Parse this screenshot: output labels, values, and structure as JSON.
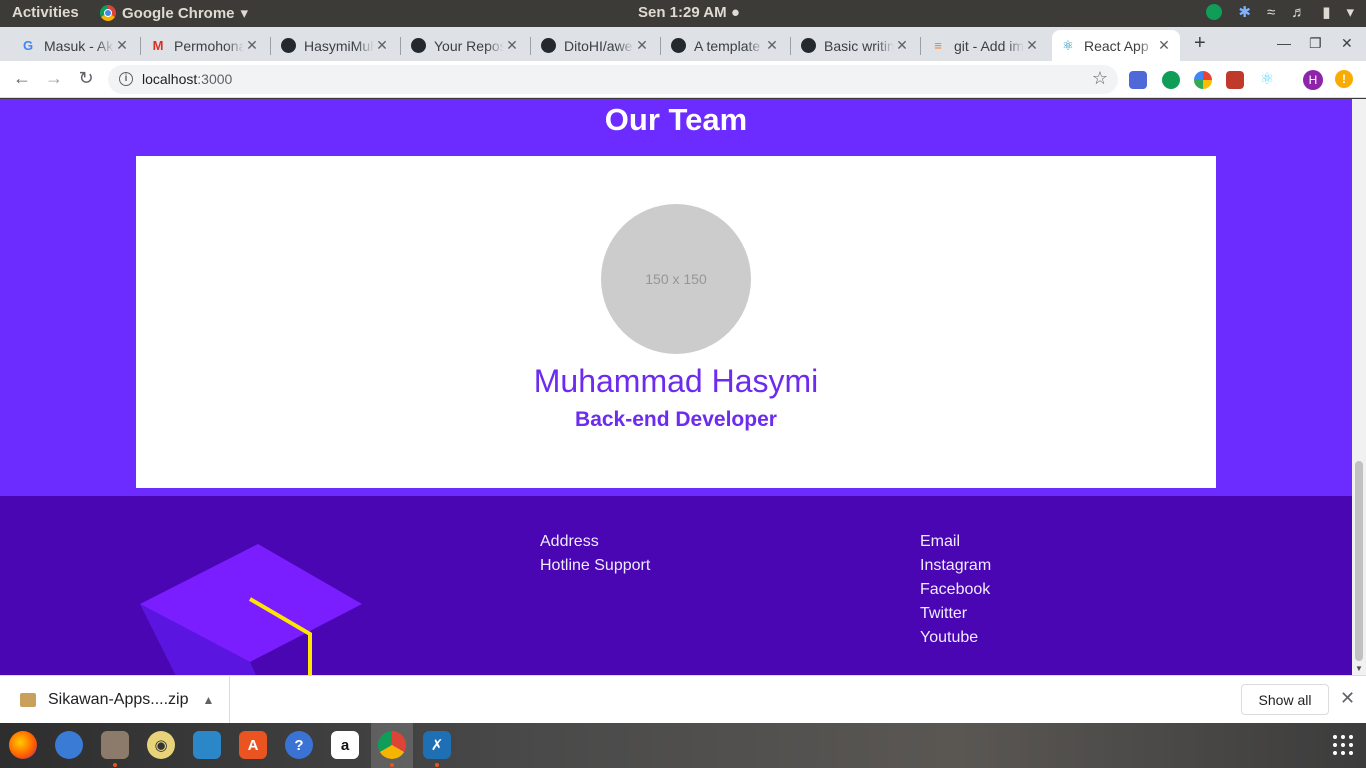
{
  "system_bar": {
    "activities": "Activities",
    "app_name": "Google Chrome",
    "clock": "Sen  1:29 AM"
  },
  "browser": {
    "tabs": [
      {
        "title": "Masuk - Akun Google",
        "icon": "google-icon"
      },
      {
        "title": "Permohonan",
        "icon": "gmail-icon"
      },
      {
        "title": "HasymiMuhammad",
        "icon": "github-icon"
      },
      {
        "title": "Your Repositories",
        "icon": "github-icon"
      },
      {
        "title": "DitoHI/awesome",
        "icon": "github-icon"
      },
      {
        "title": "A template",
        "icon": "github-icon"
      },
      {
        "title": "Basic writing",
        "icon": "github-icon"
      },
      {
        "title": "git - Add image",
        "icon": "stackoverflow-icon"
      },
      {
        "title": "React App",
        "icon": "react-icon",
        "active": true
      }
    ],
    "new_tab": "+",
    "url_host": "localhost",
    "url_port": ":3000",
    "profile_initial": "H"
  },
  "page": {
    "team_heading": "Our Team",
    "avatar_placeholder": "150 x 150",
    "member_name": "Muhammad Hasymi",
    "member_role": "Back-end Developer",
    "footer": {
      "col1": [
        "Address",
        "Hotline Support"
      ],
      "col2": [
        "Email",
        "Instagram",
        "Facebook",
        "Twitter",
        "Youtube"
      ]
    }
  },
  "downloads": {
    "file_name": "Sikawan-Apps....zip",
    "show_all": "Show all"
  },
  "colors": {
    "page_bg": "#6c2bff",
    "footer_bg": "#4a06b3",
    "accent_text": "#6c2bef"
  }
}
